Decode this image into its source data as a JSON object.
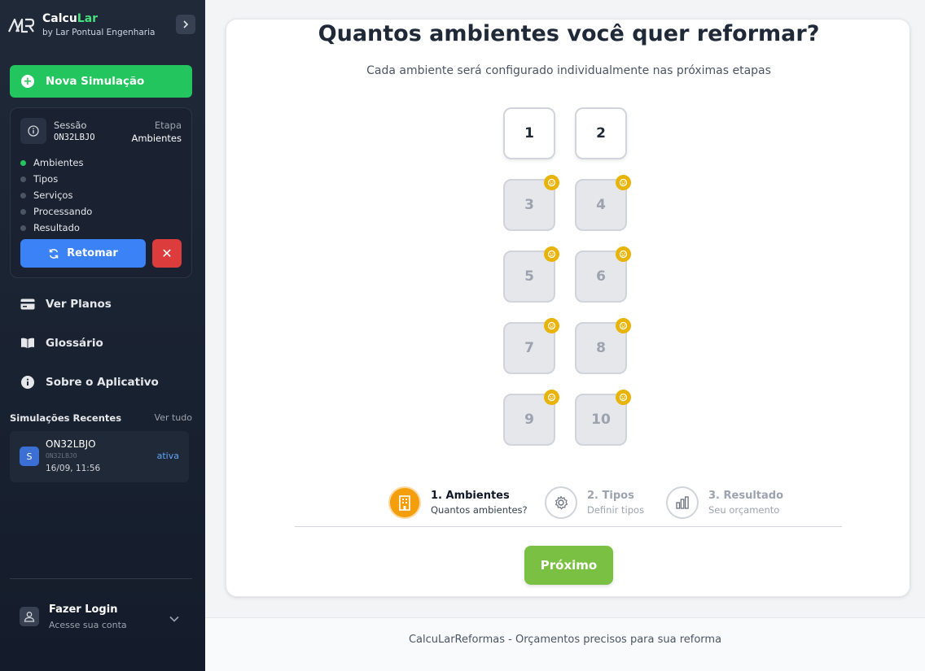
{
  "brand": {
    "name_part1": "Calcu",
    "name_part2": "Lar",
    "subtitle": "by Lar Pontual Engenharia",
    "accent_color": "#4ade80"
  },
  "sidebar": {
    "new_simulation_label": "Nova Simulação",
    "session": {
      "label": "Sessão",
      "code": "ON32LBJO",
      "stage_label": "Etapa",
      "stage_value": "Ambientes",
      "steps": [
        "Ambientes",
        "Tipos",
        "Serviços",
        "Processando",
        "Resultado"
      ],
      "active_step": "Ambientes",
      "resume_label": "Retomar",
      "close_symbol": "✕"
    },
    "nav": [
      {
        "label": "Ver Planos",
        "icon": "credit-card-icon"
      },
      {
        "label": "Glossário",
        "icon": "book-icon"
      },
      {
        "label": "Sobre o Aplicativo",
        "icon": "info-icon"
      }
    ],
    "recent": {
      "title": "Simulações Recentes",
      "view_all": "Ver tudo",
      "items": [
        {
          "avatar": "S",
          "name": "ON32LBJO",
          "code": "ON32LBJO",
          "date": "16/09, 11:56",
          "status": "ativa"
        }
      ]
    },
    "login": {
      "title": "Fazer Login",
      "subtitle": "Acesse sua conta"
    }
  },
  "main": {
    "title": "Quantos ambientes você quer reformar?",
    "subtitle": "Cada ambiente será configurado individualmente nas próximas etapas",
    "room_options": [
      {
        "value": "1",
        "locked": false
      },
      {
        "value": "2",
        "locked": false
      },
      {
        "value": "3",
        "locked": true
      },
      {
        "value": "4",
        "locked": true
      },
      {
        "value": "5",
        "locked": true
      },
      {
        "value": "6",
        "locked": true
      },
      {
        "value": "7",
        "locked": true
      },
      {
        "value": "8",
        "locked": true
      },
      {
        "value": "9",
        "locked": true
      },
      {
        "value": "10",
        "locked": true
      }
    ],
    "progress": [
      {
        "title": "1. Ambientes",
        "subtitle": "Quantos ambientes?",
        "icon": "building-icon",
        "active": true
      },
      {
        "title": "2. Tipos",
        "subtitle": "Definir tipos",
        "icon": "gear-icon",
        "active": false
      },
      {
        "title": "3. Resultado",
        "subtitle": "Seu orçamento",
        "icon": "bar-chart-icon",
        "active": false
      }
    ],
    "next_label": "Próximo"
  },
  "footer": {
    "text": "CalcuLarReformas - Orçamentos precisos para sua reforma"
  },
  "colors": {
    "primary_green": "#22c55e",
    "next_green": "#7ac143",
    "blue": "#3b82f6",
    "red": "#dc3c3c",
    "orange": "#f59e0b",
    "gold": "#eab308"
  }
}
